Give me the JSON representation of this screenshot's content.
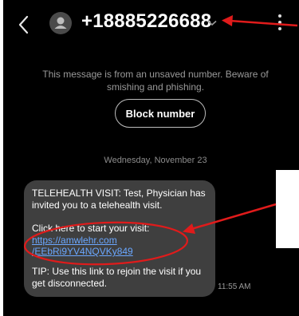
{
  "header": {
    "back_icon": "chevron-left-icon",
    "avatar_icon": "person-icon",
    "phone_number": "+18885226688",
    "dropdown_icon": "chevron-down-icon",
    "more_icon": "kebab-menu-icon"
  },
  "warning": {
    "line1": "This message is from an unsaved number. Beware of",
    "line2": "smishing and phishing."
  },
  "block_button": "Block number",
  "date_divider": "Wednesday, November 23",
  "message": {
    "line1": "TELEHEALTH VISIT: Test, Physician has",
    "line2": "invited you to a telehealth visit.",
    "line3": "Click here to start your visit:",
    "link1": "https://amwlehr.com",
    "link2": "/EEbRi9YV4NQVKy849",
    "tip1": "TIP: Use this link to rejoin the visit if you",
    "tip2": "get disconnected.",
    "time": "11:55 AM"
  },
  "colors": {
    "background": "#000000",
    "bubble": "#3f3f3f",
    "link": "#6aa7ff",
    "annotation": "#e01b1b"
  }
}
